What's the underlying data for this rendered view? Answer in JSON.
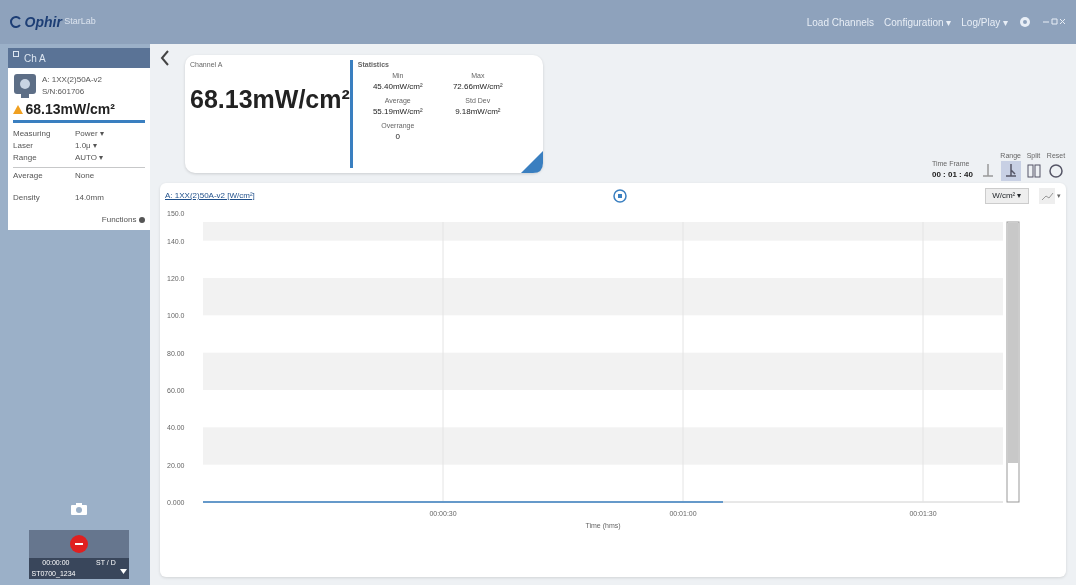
{
  "app": {
    "logo": "Ophir",
    "product": "StarLab"
  },
  "top_menu": [
    {
      "label": "Load Channels"
    },
    {
      "label": "Configuration ▾"
    },
    {
      "label": "Log/Play ▾"
    }
  ],
  "sidebar": {
    "channel_tab": "Ch A",
    "device": {
      "model": "A: 1XX(2)50A-v2",
      "serial": "S/N:601706",
      "reading": "68.13mW/cm²",
      "warning": true
    },
    "settings": [
      {
        "label": "Measuring",
        "value": "Power ▾"
      },
      {
        "label": "Laser",
        "value": "1.0μ ▾"
      },
      {
        "label": "Range",
        "value": "AUTO ▾"
      }
    ],
    "extra": [
      {
        "label": "Average",
        "value": "None"
      },
      {
        "label": "Density",
        "value": "14.0mm"
      }
    ],
    "functions": "Functions",
    "recorder": {
      "time": "00:00:00",
      "mode": "ST / D",
      "file": "ST0700_1234"
    }
  },
  "reading_card": {
    "channel": "Channel A",
    "value": "68.13mW/cm²",
    "stats_title": "Statistics",
    "stats": [
      {
        "label": "Min",
        "value": "45.40mW/cm²"
      },
      {
        "label": "Max",
        "value": "72.66mW/cm²"
      },
      {
        "label": "Average",
        "value": "55.19mW/cm²"
      },
      {
        "label": "Std Dev",
        "value": "9.18mW/cm²"
      },
      {
        "label": "Overrange",
        "value": "0"
      }
    ]
  },
  "time_frame": {
    "label": "Time Frame",
    "value": "00 : 01 : 40",
    "tools": [
      {
        "kind": "pan",
        "selected": false
      },
      {
        "kind": "range",
        "label": "Range",
        "selected": true
      },
      {
        "kind": "split",
        "label": "Split",
        "selected": false
      },
      {
        "kind": "reset",
        "label": "Reset",
        "selected": false
      }
    ]
  },
  "chart_panel": {
    "unit": "W/cm² ▾",
    "caret": "▾",
    "chart_data": {
      "type": "line",
      "grid": true,
      "xlabel": "Time (hms)",
      "ylabel": "150.0",
      "xlim": [
        0,
        100
      ],
      "ylim": [
        0,
        150
      ],
      "xticks": [
        {
          "value": 30,
          "label": "00:00:30"
        },
        {
          "value": 60,
          "label": "00:01:00"
        },
        {
          "value": 90,
          "label": "00:01:30"
        }
      ],
      "yticks": [
        {
          "value": 0,
          "label": "0.000"
        },
        {
          "value": 20,
          "label": "20.00"
        },
        {
          "value": 40,
          "label": "40.00"
        },
        {
          "value": 60,
          "label": "60.00"
        },
        {
          "value": 80,
          "label": "80.00"
        },
        {
          "value": 100,
          "label": "100.0"
        },
        {
          "value": 120,
          "label": "120.0"
        },
        {
          "value": 140,
          "label": "140.0"
        }
      ],
      "x": [
        0,
        65
      ],
      "series": [
        {
          "name": "A: 1XX(2)50A-v2 [W/cm²]",
          "color": "#3a7fc0",
          "values": [
            0,
            0
          ]
        }
      ]
    }
  }
}
